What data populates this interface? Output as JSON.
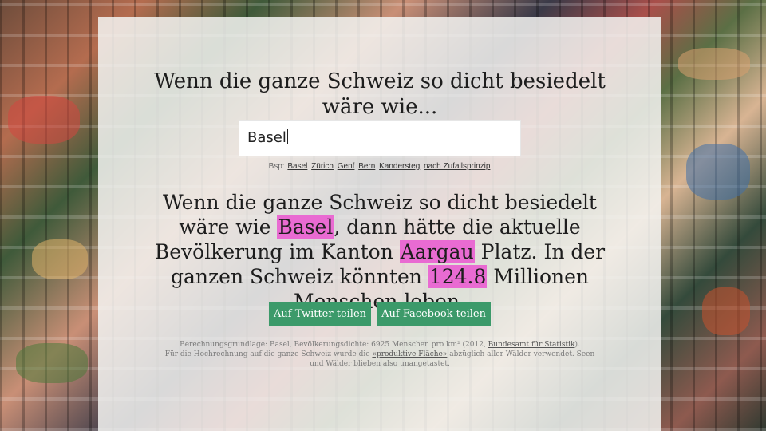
{
  "question": "Wenn die ganze Schweiz so dicht besiedelt wäre wie...",
  "input": {
    "value": "Basel"
  },
  "examples": {
    "prefix": "Bsp:",
    "links": [
      "Basel",
      "Zürich",
      "Genf",
      "Bern",
      "Kandersteg",
      "nach Zufallsprinzip"
    ]
  },
  "result": {
    "part1": "Wenn die ganze Schweiz so dicht besiedelt wäre wie ",
    "city": "Basel",
    "part2": ", dann hätte die aktuelle Bevölkerung im Kanton ",
    "canton": "Aargau",
    "part3": " Platz. In der ganzen Schweiz könnten ",
    "population": "124.8",
    "part4": " Millionen Menschen leben."
  },
  "buttons": {
    "twitter": "Auf Twitter teilen",
    "facebook": "Auf Facebook teilen"
  },
  "footer": {
    "line1_prefix": "Berechnungsgrundlage: Basel, Bevölkerungsdichte: 6925 Menschen pro km² (2012, ",
    "bfs_link": "Bundesamt für Statistik",
    "line1_suffix": ").",
    "line2_prefix": "Für die Hochrechnung auf die ganze Schweiz wurde die ",
    "flaeche_link": "«produktive Fläche»",
    "line2_suffix": " abzüglich aller Wälder verwendet. Seen und Wälder blieben also unangetastet."
  },
  "colors": {
    "highlight": "#e96bd2",
    "button": "#3c9a6a"
  }
}
